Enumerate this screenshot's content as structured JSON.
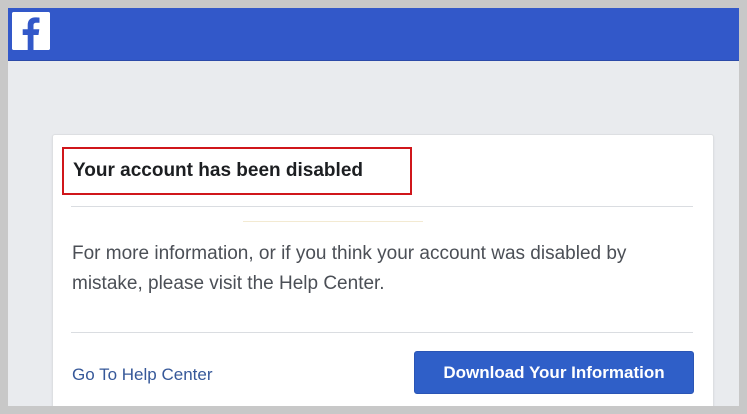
{
  "header": {
    "logo_icon": "facebook-f-icon",
    "bar_color": "#3258c9"
  },
  "card": {
    "title": "Your account has been disabled",
    "title_highlight_color": "#d0161b",
    "message": "For more information, or if you think your account was disabled by mistake, please visit the Help Center.",
    "help_link_label": "Go To Help Center",
    "download_button_label": "Download Your Information",
    "button_color": "#2f5fc8",
    "link_color": "#365899"
  }
}
